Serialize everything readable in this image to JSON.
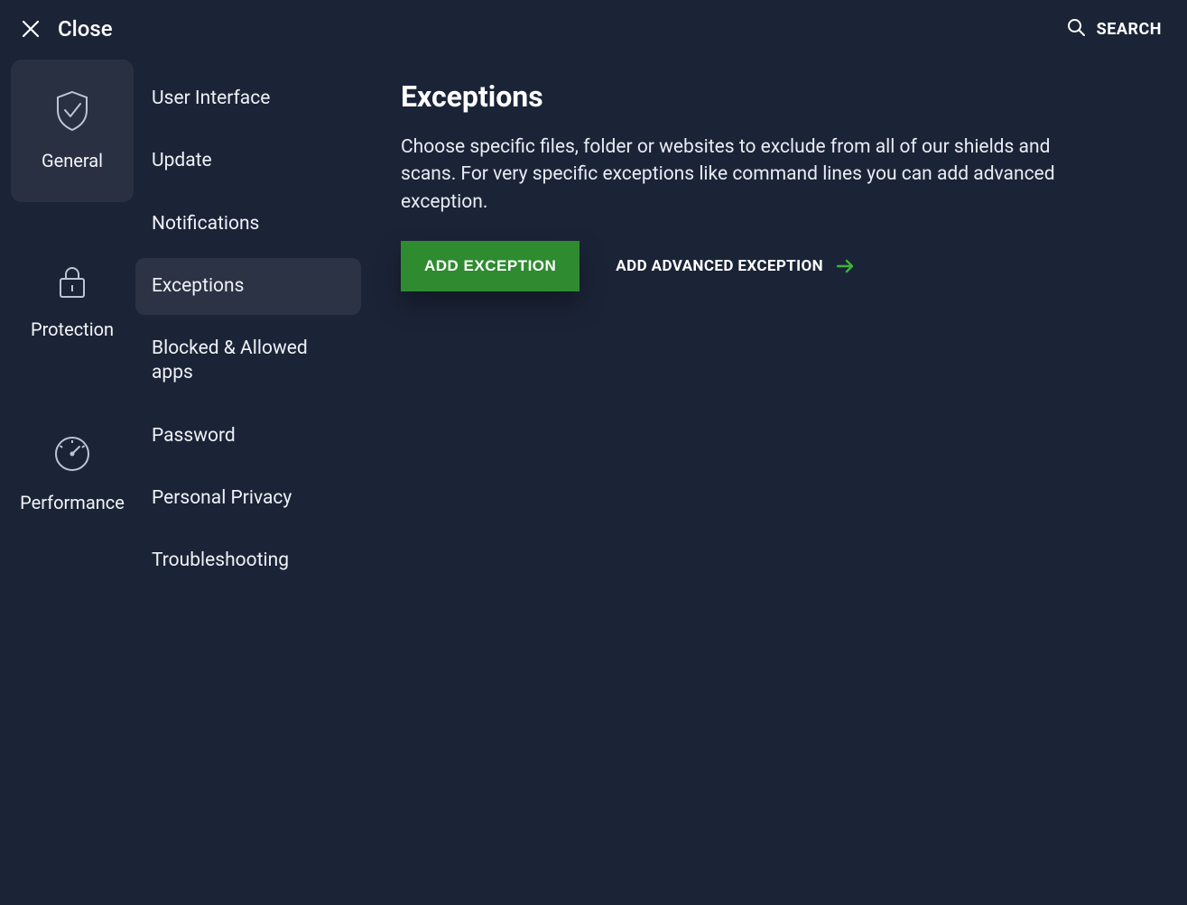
{
  "topbar": {
    "close_label": "Close",
    "search_label": "SEARCH"
  },
  "sidebar": {
    "categories": [
      {
        "id": "general",
        "label": "General",
        "selected": true
      },
      {
        "id": "protection",
        "label": "Protection",
        "selected": false
      },
      {
        "id": "performance",
        "label": "Performance",
        "selected": false
      }
    ]
  },
  "subnav": {
    "items": [
      {
        "id": "ui",
        "label": "User Interface",
        "selected": false
      },
      {
        "id": "update",
        "label": "Update",
        "selected": false
      },
      {
        "id": "notifications",
        "label": "Notifications",
        "selected": false
      },
      {
        "id": "exceptions",
        "label": "Exceptions",
        "selected": true
      },
      {
        "id": "blocked",
        "label": "Blocked & Allowed apps",
        "selected": false
      },
      {
        "id": "password",
        "label": "Password",
        "selected": false
      },
      {
        "id": "privacy",
        "label": "Personal Privacy",
        "selected": false
      },
      {
        "id": "troubleshoot",
        "label": "Troubleshooting",
        "selected": false
      }
    ]
  },
  "content": {
    "title": "Exceptions",
    "description": "Choose specific files, folder or websites to exclude from all of our shields and scans. For very specific exceptions like command lines you can add advanced exception.",
    "primary_button": "ADD EXCEPTION",
    "secondary_button": "ADD ADVANCED EXCEPTION"
  },
  "colors": {
    "accent_green": "#2e8b30",
    "arrow_green": "#3fb23f",
    "background": "#1b2437"
  }
}
